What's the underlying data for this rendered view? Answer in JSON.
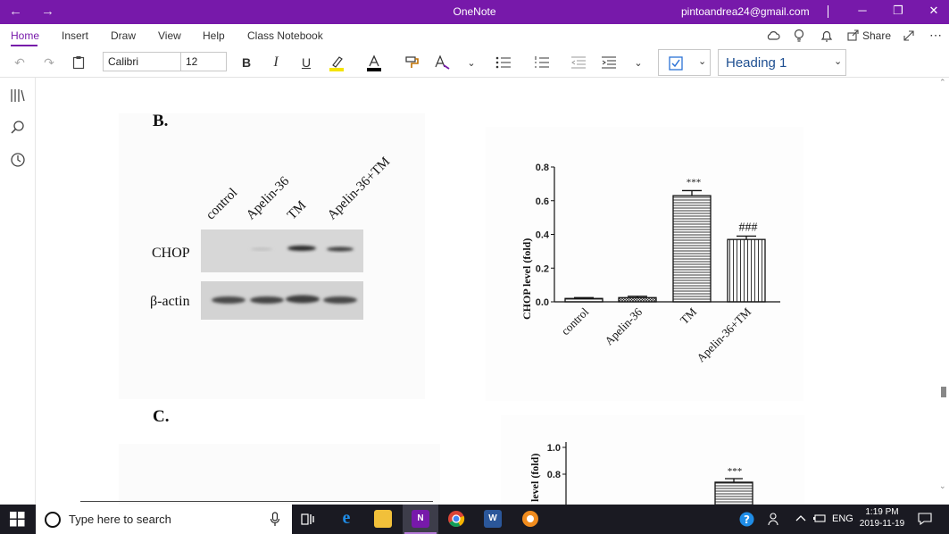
{
  "window": {
    "title": "OneNote",
    "account": "pintoandrea24@gmail.com"
  },
  "menu": {
    "tabs": [
      "Home",
      "Insert",
      "Draw",
      "View",
      "Help",
      "Class Notebook"
    ],
    "share_label": "Share"
  },
  "toolbar": {
    "font_name": "Calibri",
    "font_size": "12",
    "bold": "B",
    "italic": "I",
    "underline": "U",
    "style": "Heading 1",
    "highlight_color": "#f5e400",
    "font_color": "#000000"
  },
  "figure_b": {
    "label": "B.",
    "lanes": [
      "control",
      "Apelin-36",
      "TM",
      "Apelin-36+TM"
    ],
    "rows": [
      "CHOP",
      "β-actin"
    ]
  },
  "chart_data": [
    {
      "type": "bar",
      "ylabel": "CHOP level (fold)",
      "categories": [
        "control",
        "Apelin-36",
        "TM",
        "Apelin-36+TM"
      ],
      "values": [
        0.02,
        0.025,
        0.63,
        0.37
      ],
      "errors": [
        0.005,
        0.008,
        0.03,
        0.02
      ],
      "annotations": [
        "",
        "",
        "***",
        "###"
      ],
      "yticks": [
        "0.0",
        "0.2",
        "0.4",
        "0.6",
        "0.8"
      ],
      "ylim": [
        0,
        0.8
      ],
      "grid": false
    },
    {
      "type": "bar",
      "ylabel": "level (fold)",
      "yticks": [
        "0.8",
        "1.0"
      ],
      "annotations": [
        "***"
      ]
    }
  ],
  "figure_c": {
    "label": "C."
  },
  "taskbar": {
    "search_placeholder": "Type here to search",
    "language": "ENG",
    "time": "1:19 PM",
    "date": "2019-11-19"
  }
}
